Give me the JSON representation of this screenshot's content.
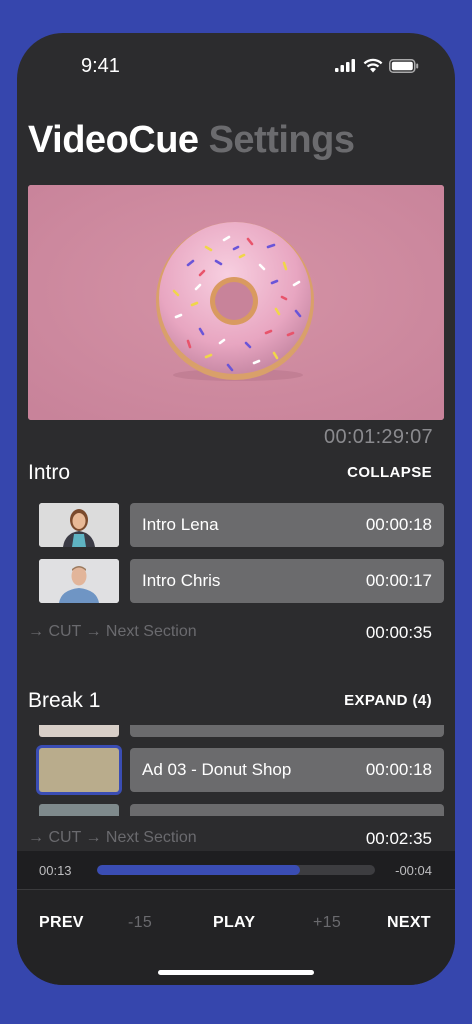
{
  "status": {
    "time": "9:41"
  },
  "header": {
    "title": "VideoCue",
    "secondary_title": "Settings"
  },
  "preview": {
    "total_duration": "00:01:29:07"
  },
  "sections": {
    "intro": {
      "title": "Intro",
      "action": "COLLAPSE",
      "items": [
        {
          "label": "Intro Lena",
          "duration": "00:00:18"
        },
        {
          "label": "Intro Chris",
          "duration": "00:00:17"
        }
      ],
      "cut_label": "→ CUT → Next Section",
      "cut_duration": "00:00:35"
    },
    "break1": {
      "title": "Break 1",
      "action": "EXPAND (4)",
      "items": [
        {
          "label": "Ad 03 - Donut Shop",
          "duration": "00:00:18"
        }
      ],
      "cut_label": "→ CUT → Next Section",
      "cut_duration": "00:02:35"
    }
  },
  "player": {
    "elapsed": "00:13",
    "remaining": "-00:04",
    "progress_percent": 73,
    "prev_label": "PREV",
    "back_label": "-15",
    "play_label": "PLAY",
    "forward_label": "+15",
    "next_label": "NEXT"
  },
  "colors": {
    "background": "#3646ad",
    "panel": "#2c2c2e",
    "accent": "#3a4db4",
    "row": "#6b6b6d"
  }
}
